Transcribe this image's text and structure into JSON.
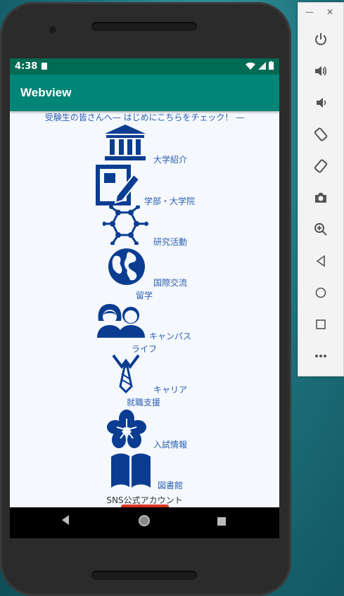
{
  "status": {
    "time": "4:38"
  },
  "appbar": {
    "title": "Webview"
  },
  "notice": "受験生の皆さんへ— はじめにこちらをチェック！ —",
  "items": [
    {
      "label": "大学紹介",
      "icon": "building-icon"
    },
    {
      "label": "学部・大学院",
      "icon": "document-pen-icon"
    },
    {
      "label": "研究活動",
      "icon": "molecule-icon"
    },
    {
      "label": "国際交流",
      "label2": "留学",
      "icon": "globe-icon"
    },
    {
      "label": "キャンパス",
      "label2": "ライフ",
      "icon": "people-icon"
    },
    {
      "label": "キャリア",
      "label2": "就職支援",
      "icon": "necktie-icon"
    },
    {
      "label": "入試情報",
      "icon": "sakura-icon"
    },
    {
      "label": "図書館",
      "icon": "book-icon"
    }
  ],
  "sns": "SNS公式アカウント",
  "toolbar": {
    "buttons": [
      "power-icon",
      "volume-up-icon",
      "volume-down-icon",
      "rotate-left-icon",
      "rotate-right-icon",
      "camera-icon",
      "zoom-icon",
      "back-icon",
      "home-icon",
      "overview-icon",
      "more-icon"
    ]
  },
  "colors": {
    "statusbar": "#006b54",
    "appbar": "#008577",
    "icon": "#0a3d91",
    "link": "#2b5fb4"
  }
}
